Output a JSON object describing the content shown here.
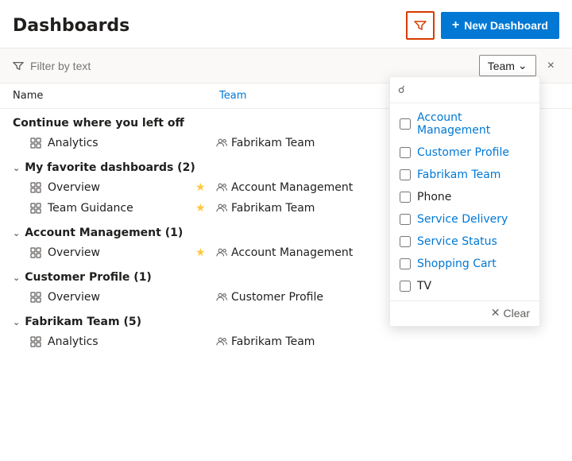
{
  "header": {
    "title": "Dashboards",
    "filter_icon_label": "Filter",
    "new_dashboard_label": "New Dashboard",
    "plus": "+"
  },
  "filter_bar": {
    "placeholder": "Filter by text",
    "team_label": "Team",
    "close_label": "×"
  },
  "table": {
    "col_name": "Name",
    "col_team": "Team"
  },
  "sections": [
    {
      "id": "continue",
      "title": "Continue where you left off",
      "collapsible": false,
      "items": [
        {
          "name": "Analytics",
          "team": "Fabrikam Team",
          "star": false
        }
      ]
    },
    {
      "id": "favorites",
      "title": "My favorite dashboards (2)",
      "collapsible": true,
      "items": [
        {
          "name": "Overview",
          "team": "Account Management",
          "star": true
        },
        {
          "name": "Team Guidance",
          "team": "Fabrikam Team",
          "star": true
        }
      ]
    },
    {
      "id": "account",
      "title": "Account Management (1)",
      "collapsible": true,
      "items": [
        {
          "name": "Overview",
          "team": "Account Management",
          "star": true
        }
      ]
    },
    {
      "id": "customer",
      "title": "Customer Profile (1)",
      "collapsible": true,
      "items": [
        {
          "name": "Overview",
          "team": "Customer Profile",
          "star": false
        }
      ]
    },
    {
      "id": "fabrikam",
      "title": "Fabrikam Team (5)",
      "collapsible": true,
      "items": [
        {
          "name": "Analytics",
          "team": "Fabrikam Team",
          "star": false
        }
      ]
    }
  ],
  "dropdown": {
    "search_placeholder": "",
    "items": [
      {
        "label": "Account Management",
        "checked": false,
        "colored": true
      },
      {
        "label": "Customer Profile",
        "checked": false,
        "colored": true
      },
      {
        "label": "Fabrikam Team",
        "checked": false,
        "colored": true
      },
      {
        "label": "Phone",
        "checked": false,
        "colored": false
      },
      {
        "label": "Service Delivery",
        "checked": false,
        "colored": true
      },
      {
        "label": "Service Status",
        "checked": false,
        "colored": true
      },
      {
        "label": "Shopping Cart",
        "checked": false,
        "colored": true
      },
      {
        "label": "TV",
        "checked": false,
        "colored": false
      }
    ],
    "clear_label": "Clear"
  }
}
